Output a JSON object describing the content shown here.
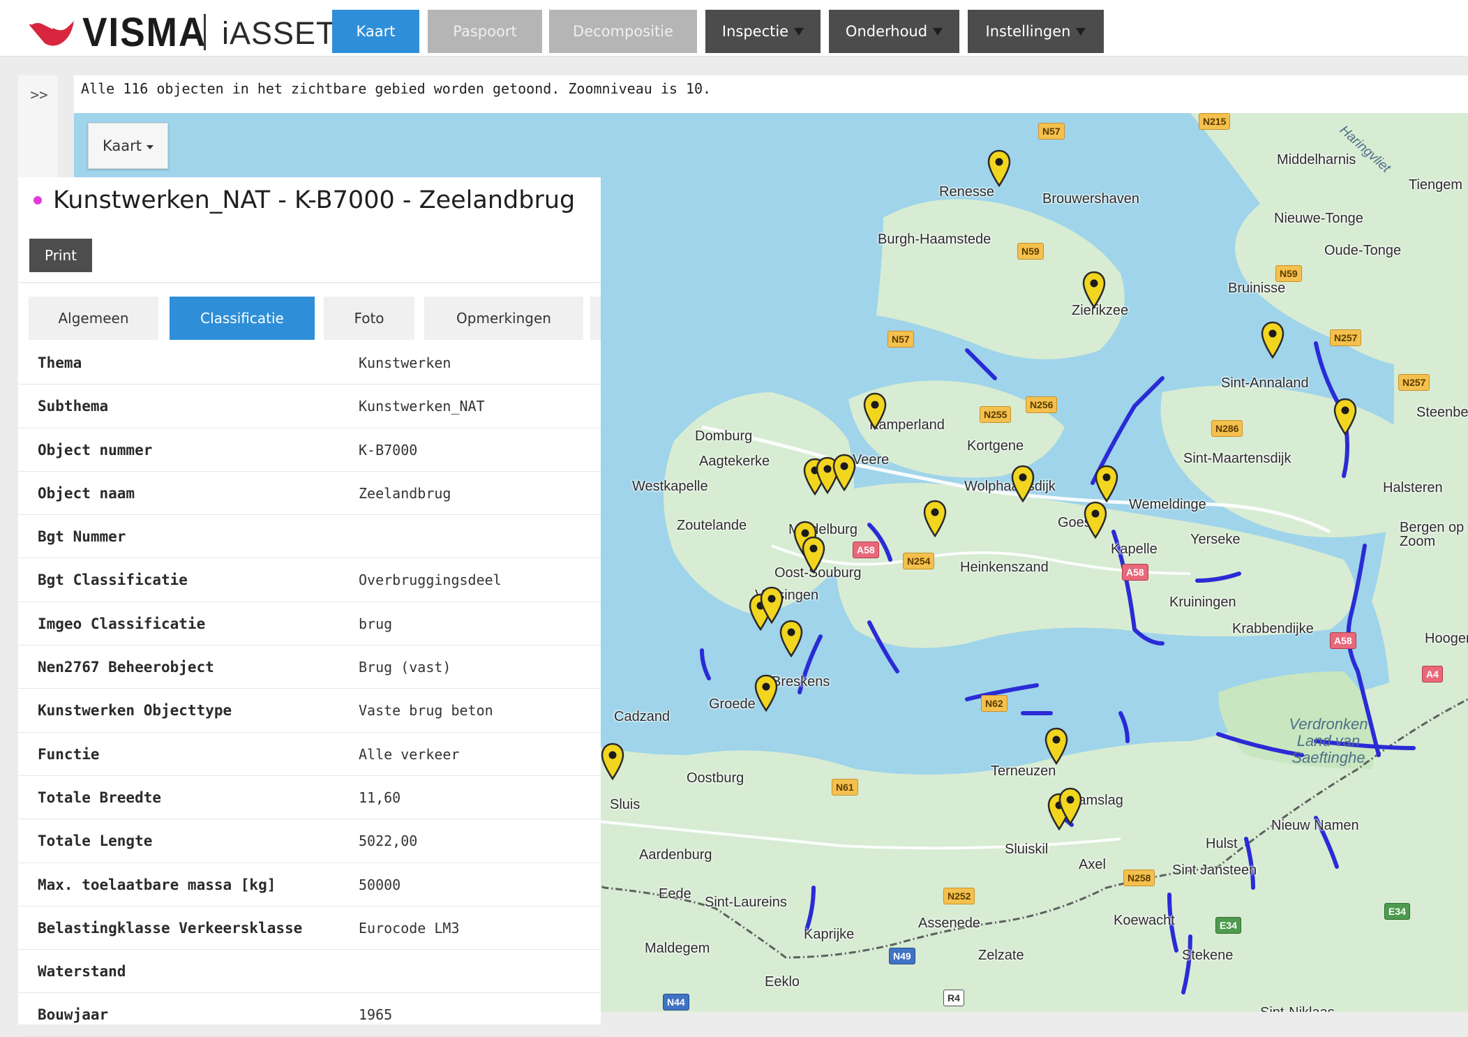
{
  "brand": {
    "logo_text": "VISMA",
    "app_name": "iASSET"
  },
  "nav": {
    "kaart": "Kaart",
    "paspoort": "Paspoort",
    "decompositie": "Decompositie",
    "inspectie": "Inspectie",
    "onderhoud": "Onderhoud",
    "instellingen": "Instellingen"
  },
  "sidebar": {
    "toggle": ">>"
  },
  "status": {
    "text": "Alle 116 objecten in het zichtbare gebied worden getoond. Zoomniveau is 10."
  },
  "map": {
    "layer_dropdown": "Kaart",
    "labels": {
      "renesse": "Renesse",
      "brouwershaven": "Brouwershaven",
      "burgh_haamstede": "Burgh-Haamstede",
      "middelharnis": "Middelharnis",
      "nieuwe_tonge": "Nieuwe-Tonge",
      "oude_tonge": "Oude-Tonge",
      "tiengem": "Tiengem",
      "bruinisse": "Bruinisse",
      "zierikzee": "Zierikzee",
      "sint_annaland": "Sint-Annaland",
      "steenbe": "Steenbe",
      "domburg": "Domburg",
      "aagtekerke": "Aagtekerke",
      "kamperland": "Kamperland",
      "veere": "Veere",
      "kortgene": "Kortgene",
      "sint_maartensdijk": "Sint-Maartensdijk",
      "westkapelle": "Westkapelle",
      "wolphaartsdijk": "Wolphaartsdijk",
      "halsteren": "Halsteren",
      "zoutelande": "Zoutelande",
      "middelburg": "Middelburg",
      "goes": "Goes",
      "wemeldinge": "Wemeldinge",
      "yerseke": "Yerseke",
      "bergen_op_zoom": "Bergen op Zoom",
      "kapelle": "Kapelle",
      "oost_souburg": "Oost-Souburg",
      "heinkenszand": "Heinkenszand",
      "vlissingen": "Vlissingen",
      "kruiningen": "Kruiningen",
      "krabbendijke": "Krabbendijke",
      "hoogerheide": "Hooger",
      "breskens": "Breskens",
      "groede": "Groede",
      "cadzand": "Cadzand",
      "saeftinghe": "Verdronken Land van Saeftinghe",
      "oostburg": "Oostburg",
      "terneuzen": "Terneuzen",
      "zaamslag": "Zaamslag",
      "sluis": "Sluis",
      "nieuw_namen": "Nieuw Namen",
      "hulst": "Hulst",
      "aardenburg": "Aardenburg",
      "sluiskil": "Sluiskil",
      "axel": "Axel",
      "sint_jansteen": "Sint Jansteen",
      "eede": "Eede",
      "sint_laureins": "Sint-Laureins",
      "assenede": "Assenede",
      "koewacht": "Koewacht",
      "kaprijke": "Kaprijke",
      "maldegem": "Maldegem",
      "zelzate": "Zelzate",
      "stekene": "Stekene",
      "eeklo": "Eeklo",
      "sint_niklaas": "Sint-Niklaas",
      "haringvliet": "Haringvliet"
    },
    "shields": {
      "n57a": "N57",
      "n57b": "N57",
      "n59a": "N59",
      "n59b": "N59",
      "n215": "N215",
      "n257a": "N257",
      "n257b": "N257",
      "n255": "N255",
      "n256": "N256",
      "n286": "N286",
      "a58a": "A58",
      "a58b": "A58",
      "n254": "N254",
      "a4": "A4",
      "n62": "N62",
      "n61": "N61",
      "n252": "N252",
      "n258": "N258",
      "e34a": "E34",
      "e34b": "E34",
      "n49": "N49",
      "n44": "N44",
      "r4": "R4",
      "a58c": "A58"
    },
    "marker_count": 22
  },
  "detail": {
    "title": "Kunstwerken_NAT - K-B7000 - Zeelandbrug",
    "print": "Print",
    "tabs": [
      "Algemeen",
      "Classificatie",
      "Foto",
      "Opmerkingen"
    ],
    "active_tab": "Classificatie",
    "properties": [
      {
        "key": "Thema",
        "value": "Kunstwerken"
      },
      {
        "key": "Subthema",
        "value": "Kunstwerken_NAT"
      },
      {
        "key": "Object nummer",
        "value": "K-B7000"
      },
      {
        "key": "Object naam",
        "value": "Zeelandbrug"
      },
      {
        "key": "Bgt Nummer",
        "value": ""
      },
      {
        "key": "Bgt Classificatie",
        "value": "Overbruggingsdeel"
      },
      {
        "key": "Imgeo Classificatie",
        "value": "brug"
      },
      {
        "key": "Nen2767 Beheerobject",
        "value": "Brug (vast)"
      },
      {
        "key": "Kunstwerken Objecttype",
        "value": "Vaste brug beton"
      },
      {
        "key": "Functie",
        "value": "Alle verkeer"
      },
      {
        "key": "Totale Breedte",
        "value": "11,60"
      },
      {
        "key": "Totale Lengte",
        "value": "5022,00"
      },
      {
        "key": "Max. toelaatbare massa [kg]",
        "value": "50000"
      },
      {
        "key": "Belastingklasse Verkeersklasse",
        "value": "Eurocode LM3"
      },
      {
        "key": "Waterstand",
        "value": ""
      },
      {
        "key": "Bouwjaar",
        "value": "1965"
      }
    ]
  },
  "colors": {
    "brand_red": "#d7263d",
    "nav_active": "#2e8fd8",
    "nav_disabled": "#b5b5b5",
    "nav_dark": "#4c4c4c",
    "map_water": "#9fd4ea",
    "map_land": "#d7ecd3",
    "route": "#2b2bd6",
    "marker": "#f2d51e",
    "title_bullet": "#e23bd8"
  }
}
